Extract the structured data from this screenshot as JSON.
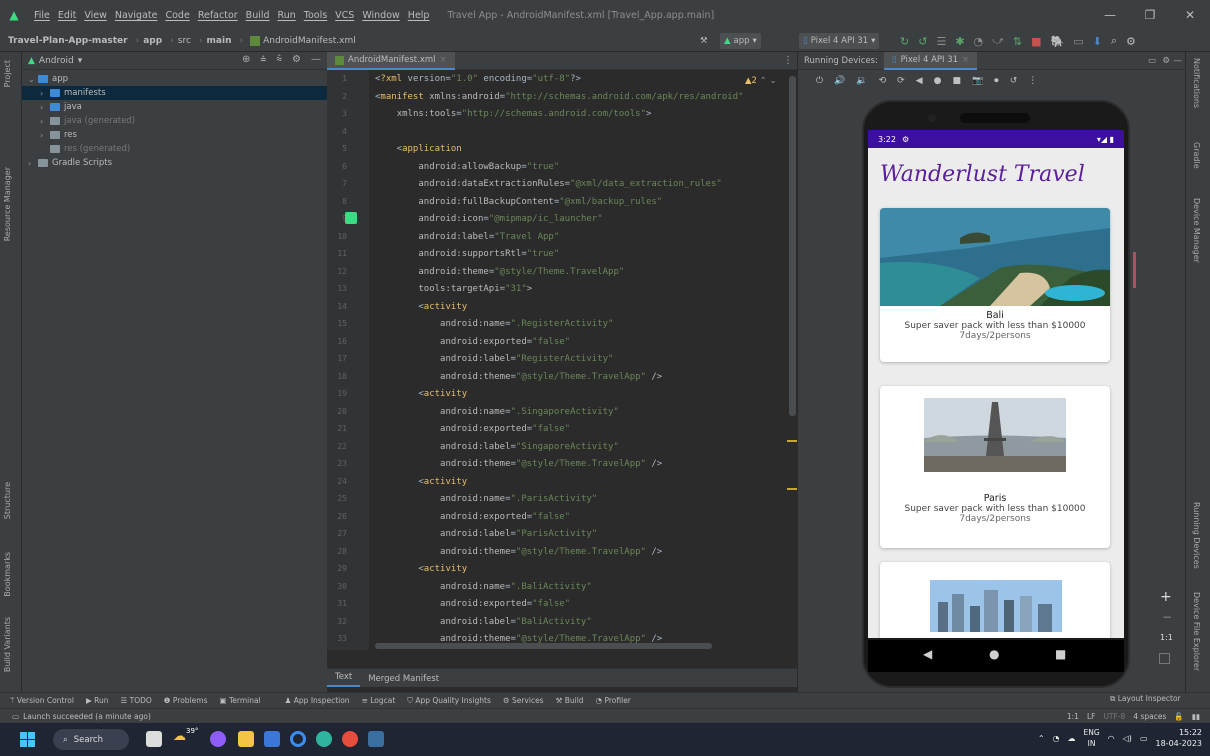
{
  "window": {
    "menu": [
      "File",
      "Edit",
      "View",
      "Navigate",
      "Code",
      "Refactor",
      "Build",
      "Run",
      "Tools",
      "VCS",
      "Window",
      "Help"
    ],
    "title": "Travel App - AndroidManifest.xml [Travel_App.app.main]",
    "controls": [
      "—",
      "❐",
      "✕"
    ]
  },
  "breadcrumb": {
    "items": [
      "Travel-Plan-App-master",
      "app",
      "src",
      "main",
      "AndroidManifest.xml"
    ]
  },
  "toolbar": {
    "run_config": "app",
    "device_select": "Pixel 4 API 31"
  },
  "project": {
    "view_label": "Android",
    "tree": [
      {
        "label": "app",
        "level": 0,
        "folder": "blue",
        "arrow": "⌄",
        "selected": false
      },
      {
        "label": "manifests",
        "level": 1,
        "folder": "blue",
        "arrow": "›",
        "selected": true
      },
      {
        "label": "java",
        "level": 1,
        "folder": "blue",
        "arrow": "›",
        "selected": false
      },
      {
        "label": "java (generated)",
        "level": 1,
        "folder": "grey",
        "arrow": "›",
        "selected": false,
        "dim": true
      },
      {
        "label": "res",
        "level": 1,
        "folder": "grey",
        "arrow": "›",
        "selected": false
      },
      {
        "label": "res (generated)",
        "level": 1,
        "folder": "grey",
        "arrow": "",
        "selected": false,
        "dim": true
      },
      {
        "label": "Gradle Scripts",
        "level": 0,
        "folder": "grey",
        "arrow": "›",
        "selected": false
      }
    ]
  },
  "left_stripe": [
    "Project",
    "Resource Manager",
    "Structure",
    "Bookmarks",
    "Build Variants"
  ],
  "right_stripe": [
    "Notifications",
    "Gradle",
    "Device Manager",
    "Running Devices",
    "Device File Explorer"
  ],
  "editor": {
    "tab": "AndroidManifest.xml",
    "warning": "▲2",
    "bottom_tabs": [
      "Text",
      "Merged Manifest"
    ],
    "lines": [
      {
        "n": "1",
        "t": "<?xml version=\"1.0\" encoding=\"utf-8\"?>"
      },
      {
        "n": "2",
        "t": "<manifest xmlns:android=\"http://schemas.android.com/apk/res/android\""
      },
      {
        "n": "3",
        "t": "    xmlns:tools=\"http://schemas.android.com/tools\">"
      },
      {
        "n": "4",
        "t": ""
      },
      {
        "n": "5",
        "t": "    <application"
      },
      {
        "n": "6",
        "t": "        android:allowBackup=\"true\""
      },
      {
        "n": "7",
        "t": "        android:dataExtractionRules=\"@xml/data_extraction_rules\""
      },
      {
        "n": "8",
        "t": "        android:fullBackupContent=\"@xml/backup_rules\""
      },
      {
        "n": "9",
        "t": "        android:icon=\"@mipmap/ic_launcher\""
      },
      {
        "n": "10",
        "t": "        android:label=\"Travel App\""
      },
      {
        "n": "11",
        "t": "        android:supportsRtl=\"true\""
      },
      {
        "n": "12",
        "t": "        android:theme=\"@style/Theme.TravelApp\""
      },
      {
        "n": "13",
        "t": "        tools:targetApi=\"31\">"
      },
      {
        "n": "14",
        "t": "        <activity"
      },
      {
        "n": "15",
        "t": "            android:name=\".RegisterActivity\""
      },
      {
        "n": "16",
        "t": "            android:exported=\"false\""
      },
      {
        "n": "17",
        "t": "            android:label=\"RegisterActivity\""
      },
      {
        "n": "18",
        "t": "            android:theme=\"@style/Theme.TravelApp\" />"
      },
      {
        "n": "19",
        "t": "        <activity"
      },
      {
        "n": "20",
        "t": "            android:name=\".SingaporeActivity\""
      },
      {
        "n": "21",
        "t": "            android:exported=\"false\""
      },
      {
        "n": "22",
        "t": "            android:label=\"SingaporeActivity\""
      },
      {
        "n": "23",
        "t": "            android:theme=\"@style/Theme.TravelApp\" />"
      },
      {
        "n": "24",
        "t": "        <activity"
      },
      {
        "n": "25",
        "t": "            android:name=\".ParisActivity\""
      },
      {
        "n": "26",
        "t": "            android:exported=\"false\""
      },
      {
        "n": "27",
        "t": "            android:label=\"ParisActivity\""
      },
      {
        "n": "28",
        "t": "            android:theme=\"@style/Theme.TravelApp\" />"
      },
      {
        "n": "29",
        "t": "        <activity"
      },
      {
        "n": "30",
        "t": "            android:name=\".BaliActivity\""
      },
      {
        "n": "31",
        "t": "            android:exported=\"false\""
      },
      {
        "n": "32",
        "t": "            android:label=\"BaliActivity\""
      },
      {
        "n": "33",
        "t": "            android:theme=\"@style/Theme.TravelApp\" />"
      }
    ]
  },
  "running_devices": {
    "label": "Running Devices:",
    "device_tab": "Pixel 4 API 31"
  },
  "phone": {
    "time": "3:22",
    "app_title": "Wanderlust Travel",
    "cards": [
      {
        "name": "Bali",
        "desc": "Super saver pack with less than $10000",
        "duration": "7days/2persons"
      },
      {
        "name": "Paris",
        "desc": "Super saver pack with less than $10000",
        "duration": "7days/2persons"
      }
    ],
    "zoom_ratio": "1:1"
  },
  "tool_windows": [
    "Version Control",
    "Run",
    "TODO",
    "Problems",
    "Terminal",
    "App Inspection",
    "Logcat",
    "App Quality Insights",
    "Services",
    "Build",
    "Profiler"
  ],
  "layout_inspector": "Layout Inspector",
  "status": {
    "message": "Launch succeeded (a minute ago)",
    "right": [
      "1:1",
      "LF",
      "UTF-8",
      "4 spaces"
    ]
  },
  "taskbar": {
    "search": "Search",
    "weather": "39°",
    "lang": "ENG",
    "lang2": "IN",
    "time": "15:22",
    "date": "18-04-2023"
  },
  "colors": {
    "accent": "#4a88c7",
    "app_purple": "#5a1f9a",
    "status_bar": "#3d0f9e"
  }
}
